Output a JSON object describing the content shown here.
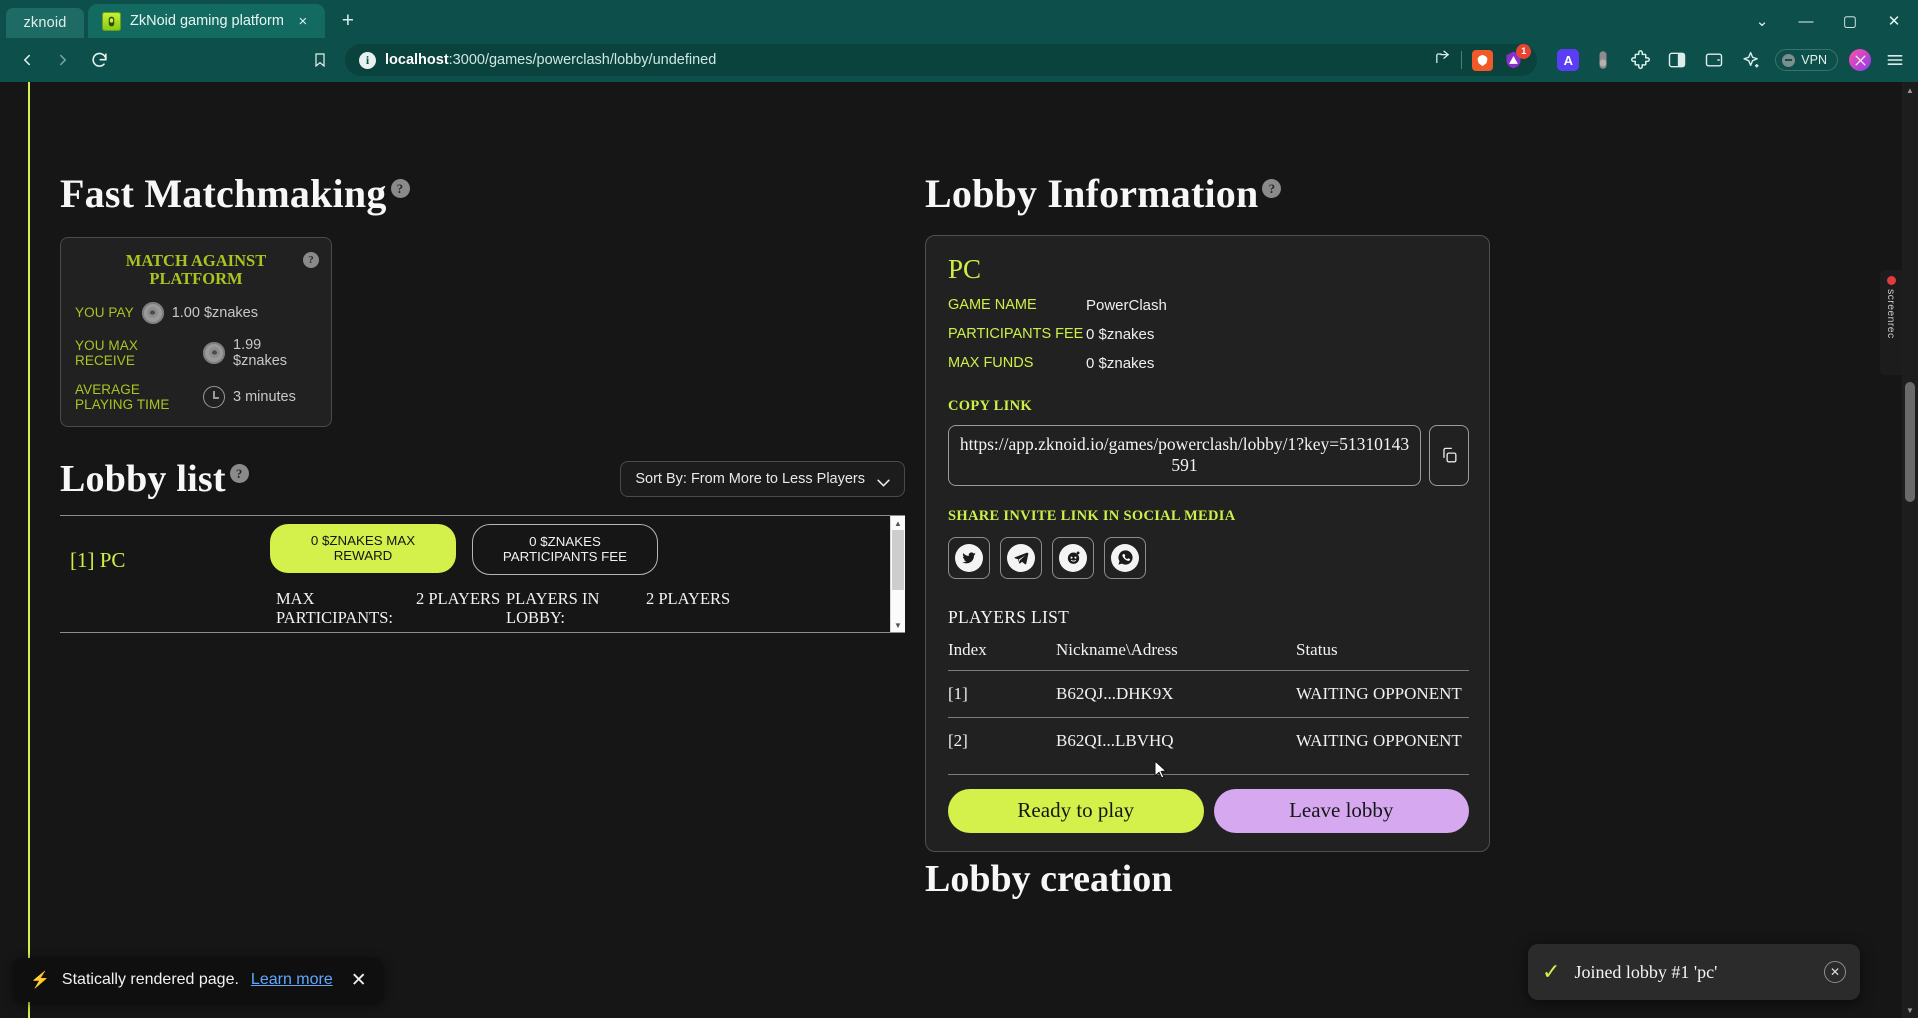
{
  "browser": {
    "window_tab_label": "zknoid",
    "tab": {
      "title": "ZkNoid gaming platform",
      "favicon": "zknoid-logo-icon",
      "close": "×"
    },
    "new_tab": "+",
    "window_controls": {
      "minimize": "—",
      "maximize": "▢",
      "close": "✕",
      "tab_search": "⌄"
    },
    "nav": {
      "back": "‹",
      "forward": "›",
      "reload": "⟳",
      "bookmark": "bookmark-icon"
    },
    "omnibox": {
      "url_host": "localhost",
      "url_path": ":3000/games/powerclash/lobby/undefined",
      "info_icon": "i",
      "share_icon": "share-icon",
      "brave_shield_icon": "brave-lion-icon",
      "shield_count": "1"
    },
    "extensions": [
      {
        "name": "1password-extension",
        "glyph": "A"
      },
      {
        "name": "wallet-pill-extension",
        "glyph": ""
      },
      {
        "name": "puzzle-extensions-icon",
        "glyph": ""
      },
      {
        "name": "sidebar-toggle-icon",
        "glyph": ""
      },
      {
        "name": "wallet-icon",
        "glyph": ""
      },
      {
        "name": "leo-ai-icon",
        "glyph": ""
      }
    ],
    "vpn": {
      "label": "VPN"
    },
    "profile": "profile-avatar",
    "menu": "hamburger-menu-icon"
  },
  "fast_matchmaking": {
    "heading": "Fast Matchmaking",
    "help": "?",
    "card": {
      "title": "MATCH AGAINST PLATFORM",
      "help": "?",
      "rows": [
        {
          "label": "YOU PAY",
          "icon": "znakes-coin-icon",
          "value": "1.00 $znakes"
        },
        {
          "label": "YOU MAX RECEIVE",
          "icon": "znakes-coin-icon",
          "value": "1.99 $znakes"
        },
        {
          "label": "AVERAGE PLAYING TIME",
          "icon": "clock-icon",
          "value": "3 minutes"
        }
      ]
    }
  },
  "lobby_list": {
    "heading": "Lobby list",
    "help": "?",
    "sort_by": "Sort By: From More to Less Players",
    "rows": [
      {
        "name": "[1] PC",
        "max_reward_badge": "0 $ZNAKES MAX REWARD",
        "participants_fee_badge": "0 $ZNAKES PARTICIPANTS FEE",
        "stats": [
          {
            "key": "MAX PARTICIPANTS:",
            "value": "2 PLAYERS"
          },
          {
            "key": "PLAYERS IN LOBBY:",
            "value": "2 PLAYERS"
          }
        ]
      }
    ]
  },
  "lobby_information": {
    "heading": "Lobby Information",
    "help": "?",
    "lobby_name": "PC",
    "details": [
      {
        "key": "GAME NAME",
        "value": "PowerClash"
      },
      {
        "key": "PARTICIPANTS FEE",
        "value": "0 $znakes"
      },
      {
        "key": "MAX FUNDS",
        "value": "0 $znakes"
      }
    ],
    "copy_link_label": "COPY LINK",
    "copy_link_value": "https://app.zknoid.io/games/powerclash/lobby/1?key=51310143591",
    "copy_button_icon": "copy-icon",
    "share_label": "SHARE INVITE LINK IN SOCIAL MEDIA",
    "socials": [
      {
        "name": "twitter-share-icon",
        "glyph": "🐦"
      },
      {
        "name": "telegram-share-icon",
        "glyph": "➤"
      },
      {
        "name": "reddit-share-icon",
        "glyph": "👽"
      },
      {
        "name": "whatsapp-share-icon",
        "glyph": "✆"
      }
    ],
    "players_list_title": "PLAYERS LIST",
    "table_headers": [
      "Index",
      "Nickname\\Adress",
      "Status"
    ],
    "players": [
      {
        "index": "[1]",
        "nickname": "B62QJ...DHK9X",
        "status": "WAITING OPPONENT"
      },
      {
        "index": "[2]",
        "nickname": "B62QI...LBVHQ",
        "status": "WAITING OPPONENT"
      }
    ],
    "ready_button": "Ready to play",
    "leave_button": "Leave lobby"
  },
  "lobby_creation_heading": "Lobby creation",
  "toast": {
    "check": "✓",
    "message": "Joined lobby #1 'pc'",
    "close": "✕"
  },
  "dev_indicator": {
    "bolt": "⚡",
    "text": "Statically rendered page.",
    "link": "Learn more",
    "close": "✕"
  },
  "screenrec": {
    "label": "screenrec"
  },
  "colors": {
    "accent_green": "#d4f04a",
    "accent_lime_text": "#cdf049",
    "olive_label": "#a9c522",
    "purple_button": "#d5a8f0",
    "browser_teal": "#0d4f4a",
    "page_bg": "#161616",
    "card_bg": "#212121"
  }
}
